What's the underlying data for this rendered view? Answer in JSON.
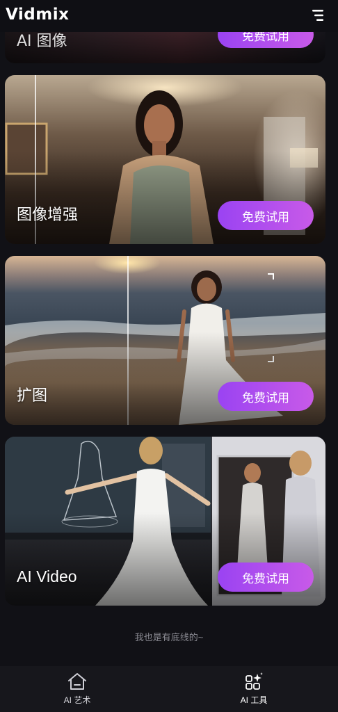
{
  "app": {
    "title": "Vidmix"
  },
  "header": {
    "menu_icon": "menu-icon"
  },
  "cards": [
    {
      "title": "AI 图像",
      "button": "免费试用"
    },
    {
      "title": "图像增强",
      "button": "免费试用"
    },
    {
      "title": "扩图",
      "button": "免费试用"
    },
    {
      "title": "AI Video",
      "button": "免费试用"
    }
  ],
  "footer_note": "我也是有底线的~",
  "tabbar": {
    "items": [
      {
        "label": "AI 艺术",
        "icon": "home-icon"
      },
      {
        "label": "AI 工具",
        "icon": "tools-grid-icon"
      }
    ]
  },
  "colors": {
    "accent_start": "#9a43f2",
    "accent_end": "#c85ae8",
    "background": "#111116"
  }
}
